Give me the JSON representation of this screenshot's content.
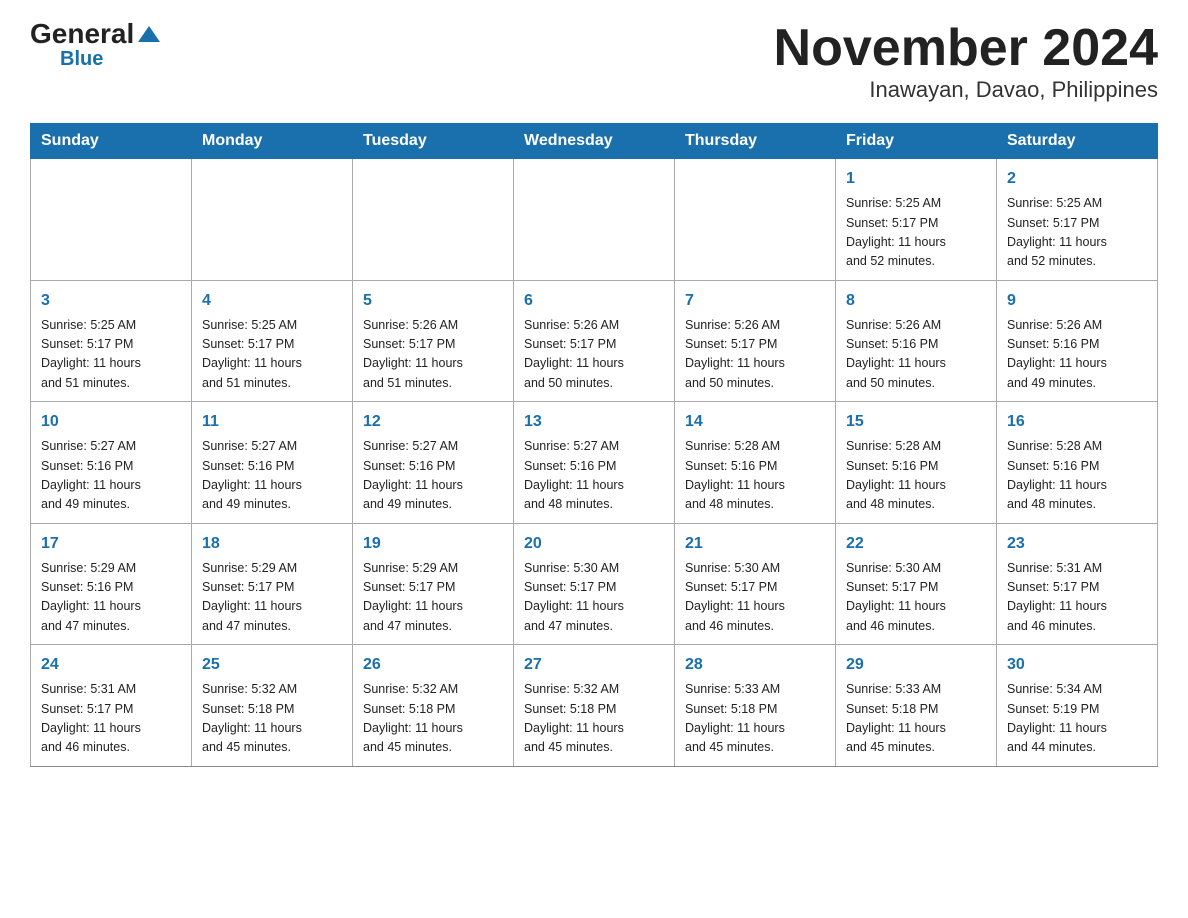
{
  "header": {
    "logo_general": "General",
    "logo_blue": "Blue",
    "title": "November 2024",
    "subtitle": "Inawayan, Davao, Philippines"
  },
  "days_of_week": [
    "Sunday",
    "Monday",
    "Tuesday",
    "Wednesday",
    "Thursday",
    "Friday",
    "Saturday"
  ],
  "weeks": [
    [
      {
        "day": "",
        "info": ""
      },
      {
        "day": "",
        "info": ""
      },
      {
        "day": "",
        "info": ""
      },
      {
        "day": "",
        "info": ""
      },
      {
        "day": "",
        "info": ""
      },
      {
        "day": "1",
        "info": "Sunrise: 5:25 AM\nSunset: 5:17 PM\nDaylight: 11 hours\nand 52 minutes."
      },
      {
        "day": "2",
        "info": "Sunrise: 5:25 AM\nSunset: 5:17 PM\nDaylight: 11 hours\nand 52 minutes."
      }
    ],
    [
      {
        "day": "3",
        "info": "Sunrise: 5:25 AM\nSunset: 5:17 PM\nDaylight: 11 hours\nand 51 minutes."
      },
      {
        "day": "4",
        "info": "Sunrise: 5:25 AM\nSunset: 5:17 PM\nDaylight: 11 hours\nand 51 minutes."
      },
      {
        "day": "5",
        "info": "Sunrise: 5:26 AM\nSunset: 5:17 PM\nDaylight: 11 hours\nand 51 minutes."
      },
      {
        "day": "6",
        "info": "Sunrise: 5:26 AM\nSunset: 5:17 PM\nDaylight: 11 hours\nand 50 minutes."
      },
      {
        "day": "7",
        "info": "Sunrise: 5:26 AM\nSunset: 5:17 PM\nDaylight: 11 hours\nand 50 minutes."
      },
      {
        "day": "8",
        "info": "Sunrise: 5:26 AM\nSunset: 5:16 PM\nDaylight: 11 hours\nand 50 minutes."
      },
      {
        "day": "9",
        "info": "Sunrise: 5:26 AM\nSunset: 5:16 PM\nDaylight: 11 hours\nand 49 minutes."
      }
    ],
    [
      {
        "day": "10",
        "info": "Sunrise: 5:27 AM\nSunset: 5:16 PM\nDaylight: 11 hours\nand 49 minutes."
      },
      {
        "day": "11",
        "info": "Sunrise: 5:27 AM\nSunset: 5:16 PM\nDaylight: 11 hours\nand 49 minutes."
      },
      {
        "day": "12",
        "info": "Sunrise: 5:27 AM\nSunset: 5:16 PM\nDaylight: 11 hours\nand 49 minutes."
      },
      {
        "day": "13",
        "info": "Sunrise: 5:27 AM\nSunset: 5:16 PM\nDaylight: 11 hours\nand 48 minutes."
      },
      {
        "day": "14",
        "info": "Sunrise: 5:28 AM\nSunset: 5:16 PM\nDaylight: 11 hours\nand 48 minutes."
      },
      {
        "day": "15",
        "info": "Sunrise: 5:28 AM\nSunset: 5:16 PM\nDaylight: 11 hours\nand 48 minutes."
      },
      {
        "day": "16",
        "info": "Sunrise: 5:28 AM\nSunset: 5:16 PM\nDaylight: 11 hours\nand 48 minutes."
      }
    ],
    [
      {
        "day": "17",
        "info": "Sunrise: 5:29 AM\nSunset: 5:16 PM\nDaylight: 11 hours\nand 47 minutes."
      },
      {
        "day": "18",
        "info": "Sunrise: 5:29 AM\nSunset: 5:17 PM\nDaylight: 11 hours\nand 47 minutes."
      },
      {
        "day": "19",
        "info": "Sunrise: 5:29 AM\nSunset: 5:17 PM\nDaylight: 11 hours\nand 47 minutes."
      },
      {
        "day": "20",
        "info": "Sunrise: 5:30 AM\nSunset: 5:17 PM\nDaylight: 11 hours\nand 47 minutes."
      },
      {
        "day": "21",
        "info": "Sunrise: 5:30 AM\nSunset: 5:17 PM\nDaylight: 11 hours\nand 46 minutes."
      },
      {
        "day": "22",
        "info": "Sunrise: 5:30 AM\nSunset: 5:17 PM\nDaylight: 11 hours\nand 46 minutes."
      },
      {
        "day": "23",
        "info": "Sunrise: 5:31 AM\nSunset: 5:17 PM\nDaylight: 11 hours\nand 46 minutes."
      }
    ],
    [
      {
        "day": "24",
        "info": "Sunrise: 5:31 AM\nSunset: 5:17 PM\nDaylight: 11 hours\nand 46 minutes."
      },
      {
        "day": "25",
        "info": "Sunrise: 5:32 AM\nSunset: 5:18 PM\nDaylight: 11 hours\nand 45 minutes."
      },
      {
        "day": "26",
        "info": "Sunrise: 5:32 AM\nSunset: 5:18 PM\nDaylight: 11 hours\nand 45 minutes."
      },
      {
        "day": "27",
        "info": "Sunrise: 5:32 AM\nSunset: 5:18 PM\nDaylight: 11 hours\nand 45 minutes."
      },
      {
        "day": "28",
        "info": "Sunrise: 5:33 AM\nSunset: 5:18 PM\nDaylight: 11 hours\nand 45 minutes."
      },
      {
        "day": "29",
        "info": "Sunrise: 5:33 AM\nSunset: 5:18 PM\nDaylight: 11 hours\nand 45 minutes."
      },
      {
        "day": "30",
        "info": "Sunrise: 5:34 AM\nSunset: 5:19 PM\nDaylight: 11 hours\nand 44 minutes."
      }
    ]
  ]
}
